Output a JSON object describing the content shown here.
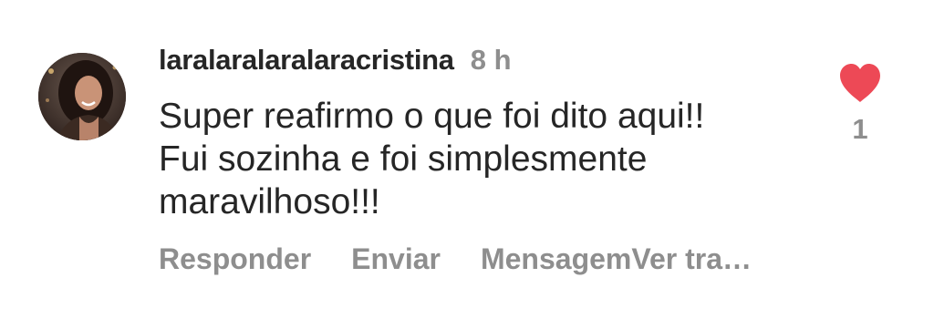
{
  "comment": {
    "username": "laralaralaralaracristina",
    "time": "8 h",
    "text_lines": [
      "Super reafirmo o que foi dito aqui!!",
      "Fui sozinha e foi simplesmente",
      "maravilhoso!!!"
    ],
    "actions": {
      "reply": "Responder",
      "send": "Enviar",
      "message_translate": "MensagemVer tra…"
    },
    "like": {
      "icon": "heart-icon",
      "liked": true,
      "count": "1",
      "color": "#ed4956"
    }
  }
}
